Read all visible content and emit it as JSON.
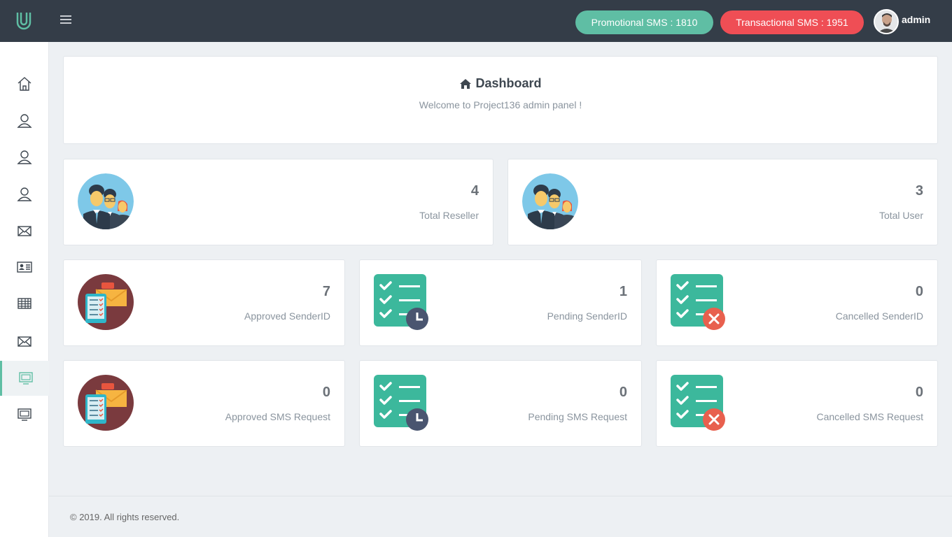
{
  "topbar": {
    "promo_label": "Promotional SMS : 1810",
    "trans_label": "Transactional SMS : 1951",
    "user_name": "admin"
  },
  "sidebar": {
    "items": [
      {
        "icon": "home-icon"
      },
      {
        "icon": "user-icon"
      },
      {
        "icon": "user-icon"
      },
      {
        "icon": "user-icon"
      },
      {
        "icon": "envelope-icon"
      },
      {
        "icon": "id-card-icon"
      },
      {
        "icon": "table-icon"
      },
      {
        "icon": "envelope-icon"
      },
      {
        "icon": "monitor-icon",
        "active": true
      },
      {
        "icon": "monitor-icon"
      }
    ]
  },
  "header": {
    "title": "Dashboard",
    "subtitle": "Welcome to Project136 admin panel !"
  },
  "stats": {
    "total_reseller": {
      "value": "4",
      "label": "Total Reseller"
    },
    "total_user": {
      "value": "3",
      "label": "Total User"
    },
    "approved_senderid": {
      "value": "7",
      "label": "Approved SenderID"
    },
    "pending_senderid": {
      "value": "1",
      "label": "Pending SenderID"
    },
    "cancelled_senderid": {
      "value": "0",
      "label": "Cancelled SenderID"
    },
    "approved_sms": {
      "value": "0",
      "label": "Approved SMS Request"
    },
    "pending_sms": {
      "value": "0",
      "label": "Pending SMS Request"
    },
    "cancelled_sms": {
      "value": "0",
      "label": "Cancelled SMS Request"
    }
  },
  "footer": {
    "text": "© 2019. All rights reserved."
  },
  "colors": {
    "topbar": "#343d48",
    "accent": "#5fbea4",
    "danger": "#ef4e55",
    "sky": "#7ec8e8"
  }
}
